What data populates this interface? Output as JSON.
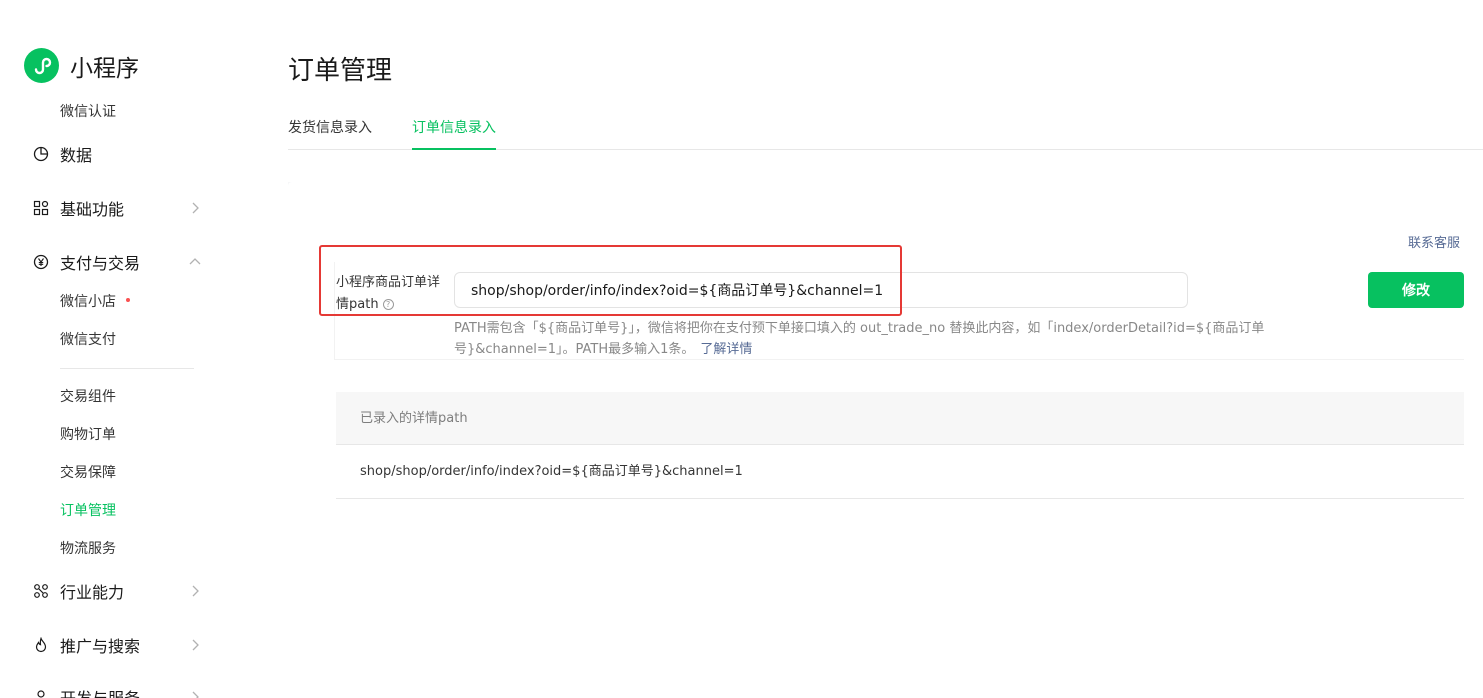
{
  "app": {
    "title": "小程序"
  },
  "sidebar": {
    "top_sub": "微信认证",
    "groups": {
      "data": {
        "label": "数据",
        "icon": "pie-chart-icon"
      },
      "basic": {
        "label": "基础功能",
        "icon": "grid-icon"
      },
      "pay": {
        "label": "支付与交易",
        "icon": "yen-circle-icon"
      },
      "industry": {
        "label": "行业能力",
        "icon": "nodes-icon"
      },
      "promo": {
        "label": "推广与搜索",
        "icon": "flame-icon"
      },
      "dev": {
        "label": "开发与服务",
        "icon": "user-icon"
      }
    },
    "pay_items": [
      "微信小店",
      "微信支付",
      "交易组件",
      "购物订单",
      "交易保障",
      "订单管理",
      "物流服务"
    ]
  },
  "main": {
    "title": "订单管理",
    "tabs": [
      "发货信息录入",
      "订单信息录入"
    ],
    "contact": "联系客服",
    "field_label": "小程序商品订单详情path",
    "path_value": "shop/shop/order/info/index?oid=${商品订单号}&channel=1",
    "modify_button": "修改",
    "hint": "PATH需包含「${商品订单号}」，微信将把你在支付预下单接口填入的 out_trade_no 替换此内容，如「index/orderDetail?id=${商品订单号}&channel=1」。PATH最多输入1条。",
    "hint_link": "了解详情",
    "table": {
      "header": "已录入的详情path",
      "rows": [
        "shop/shop/order/info/index?oid=${商品订单号}&channel=1"
      ]
    }
  },
  "colors": {
    "accent": "#07c160",
    "link": "#576b95",
    "highlight": "#e53935"
  }
}
